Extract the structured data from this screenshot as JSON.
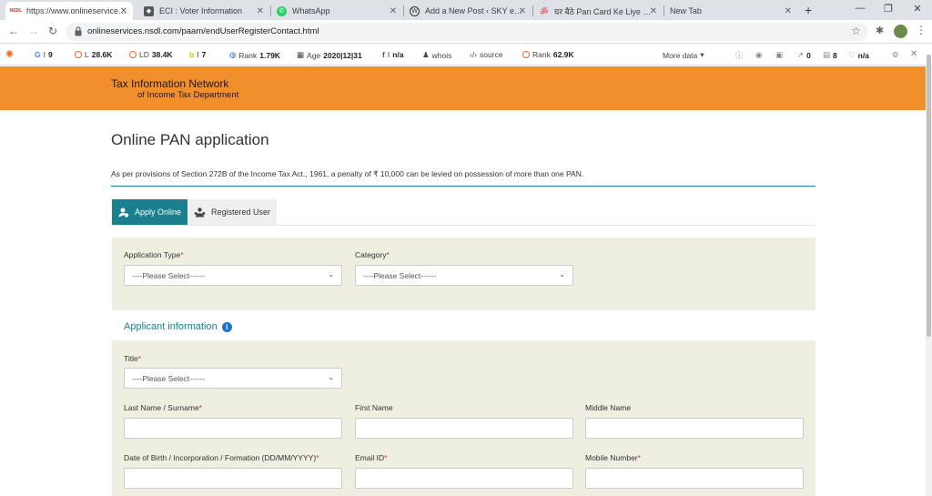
{
  "browser": {
    "tabs": [
      {
        "title": "https://www.onlineservices.n",
        "favicon": "nsdl-icon",
        "active": true
      },
      {
        "title": "ECI : Voter Information",
        "favicon": "eci-icon"
      },
      {
        "title": "WhatsApp",
        "favicon": "whatsapp-icon"
      },
      {
        "title": "Add a New Post ‹ SKY edu C",
        "favicon": "wordpress-icon"
      },
      {
        "title": "घर बैठे Pan Card Ke Liye Onli",
        "favicon": "om-icon"
      },
      {
        "title": "New Tab",
        "favicon": ""
      }
    ],
    "new_tab": "+",
    "url": "onlineservices.nsdl.com/paam/endUserRegisterContact.html"
  },
  "seo_bar": {
    "g": "9",
    "l_label": "L",
    "l_value": "28.6K",
    "ld_label": "LD",
    "ld_value": "38.4K",
    "i_label": "I",
    "i_value": "7",
    "rank_label": "Rank",
    "rank_value": "1.79K",
    "age_label": "Age",
    "age_value": "2020|12|31",
    "fb_value": "n/a",
    "whois": "whois",
    "source": "source",
    "rank2_label": "Rank",
    "rank2_value": "62.9K",
    "more_data": "More data",
    "links_out": "0",
    "pages": "8",
    "na2": "n/a"
  },
  "header": {
    "brand_line1": "Tax Information Network",
    "brand_line2": "of Income Tax Department"
  },
  "page": {
    "title": "Online PAN application",
    "penalty_notice": "As per provisions of Section 272B of the Income Tax Act., 1961, a penalty of ₹ 10,000 can be levied on possession of more than one PAN.",
    "tabs": {
      "apply": "Apply Online",
      "registered": "Registered User"
    }
  },
  "form": {
    "application_type": {
      "label": "Application Type",
      "value": "----Please Select------"
    },
    "category": {
      "label": "Category",
      "value": "----Please Select------"
    },
    "section_title": "Applicant information",
    "title": {
      "label": "Title",
      "value": "----Please Select------"
    },
    "last_name": {
      "label": "Last Name / Surname"
    },
    "first_name": {
      "label": "First Name"
    },
    "middle_name": {
      "label": "Middle Name"
    },
    "dob": {
      "label": "Date of Birth / Incorporation / Formation (DD/MM/YYYY)"
    },
    "email": {
      "label": "Email ID"
    },
    "mobile": {
      "label": "Mobile Number"
    },
    "required_mark": "*"
  },
  "colors": {
    "accent": "#1a7f8e",
    "header": "#f28f2d",
    "panel": "#eeeee1"
  }
}
